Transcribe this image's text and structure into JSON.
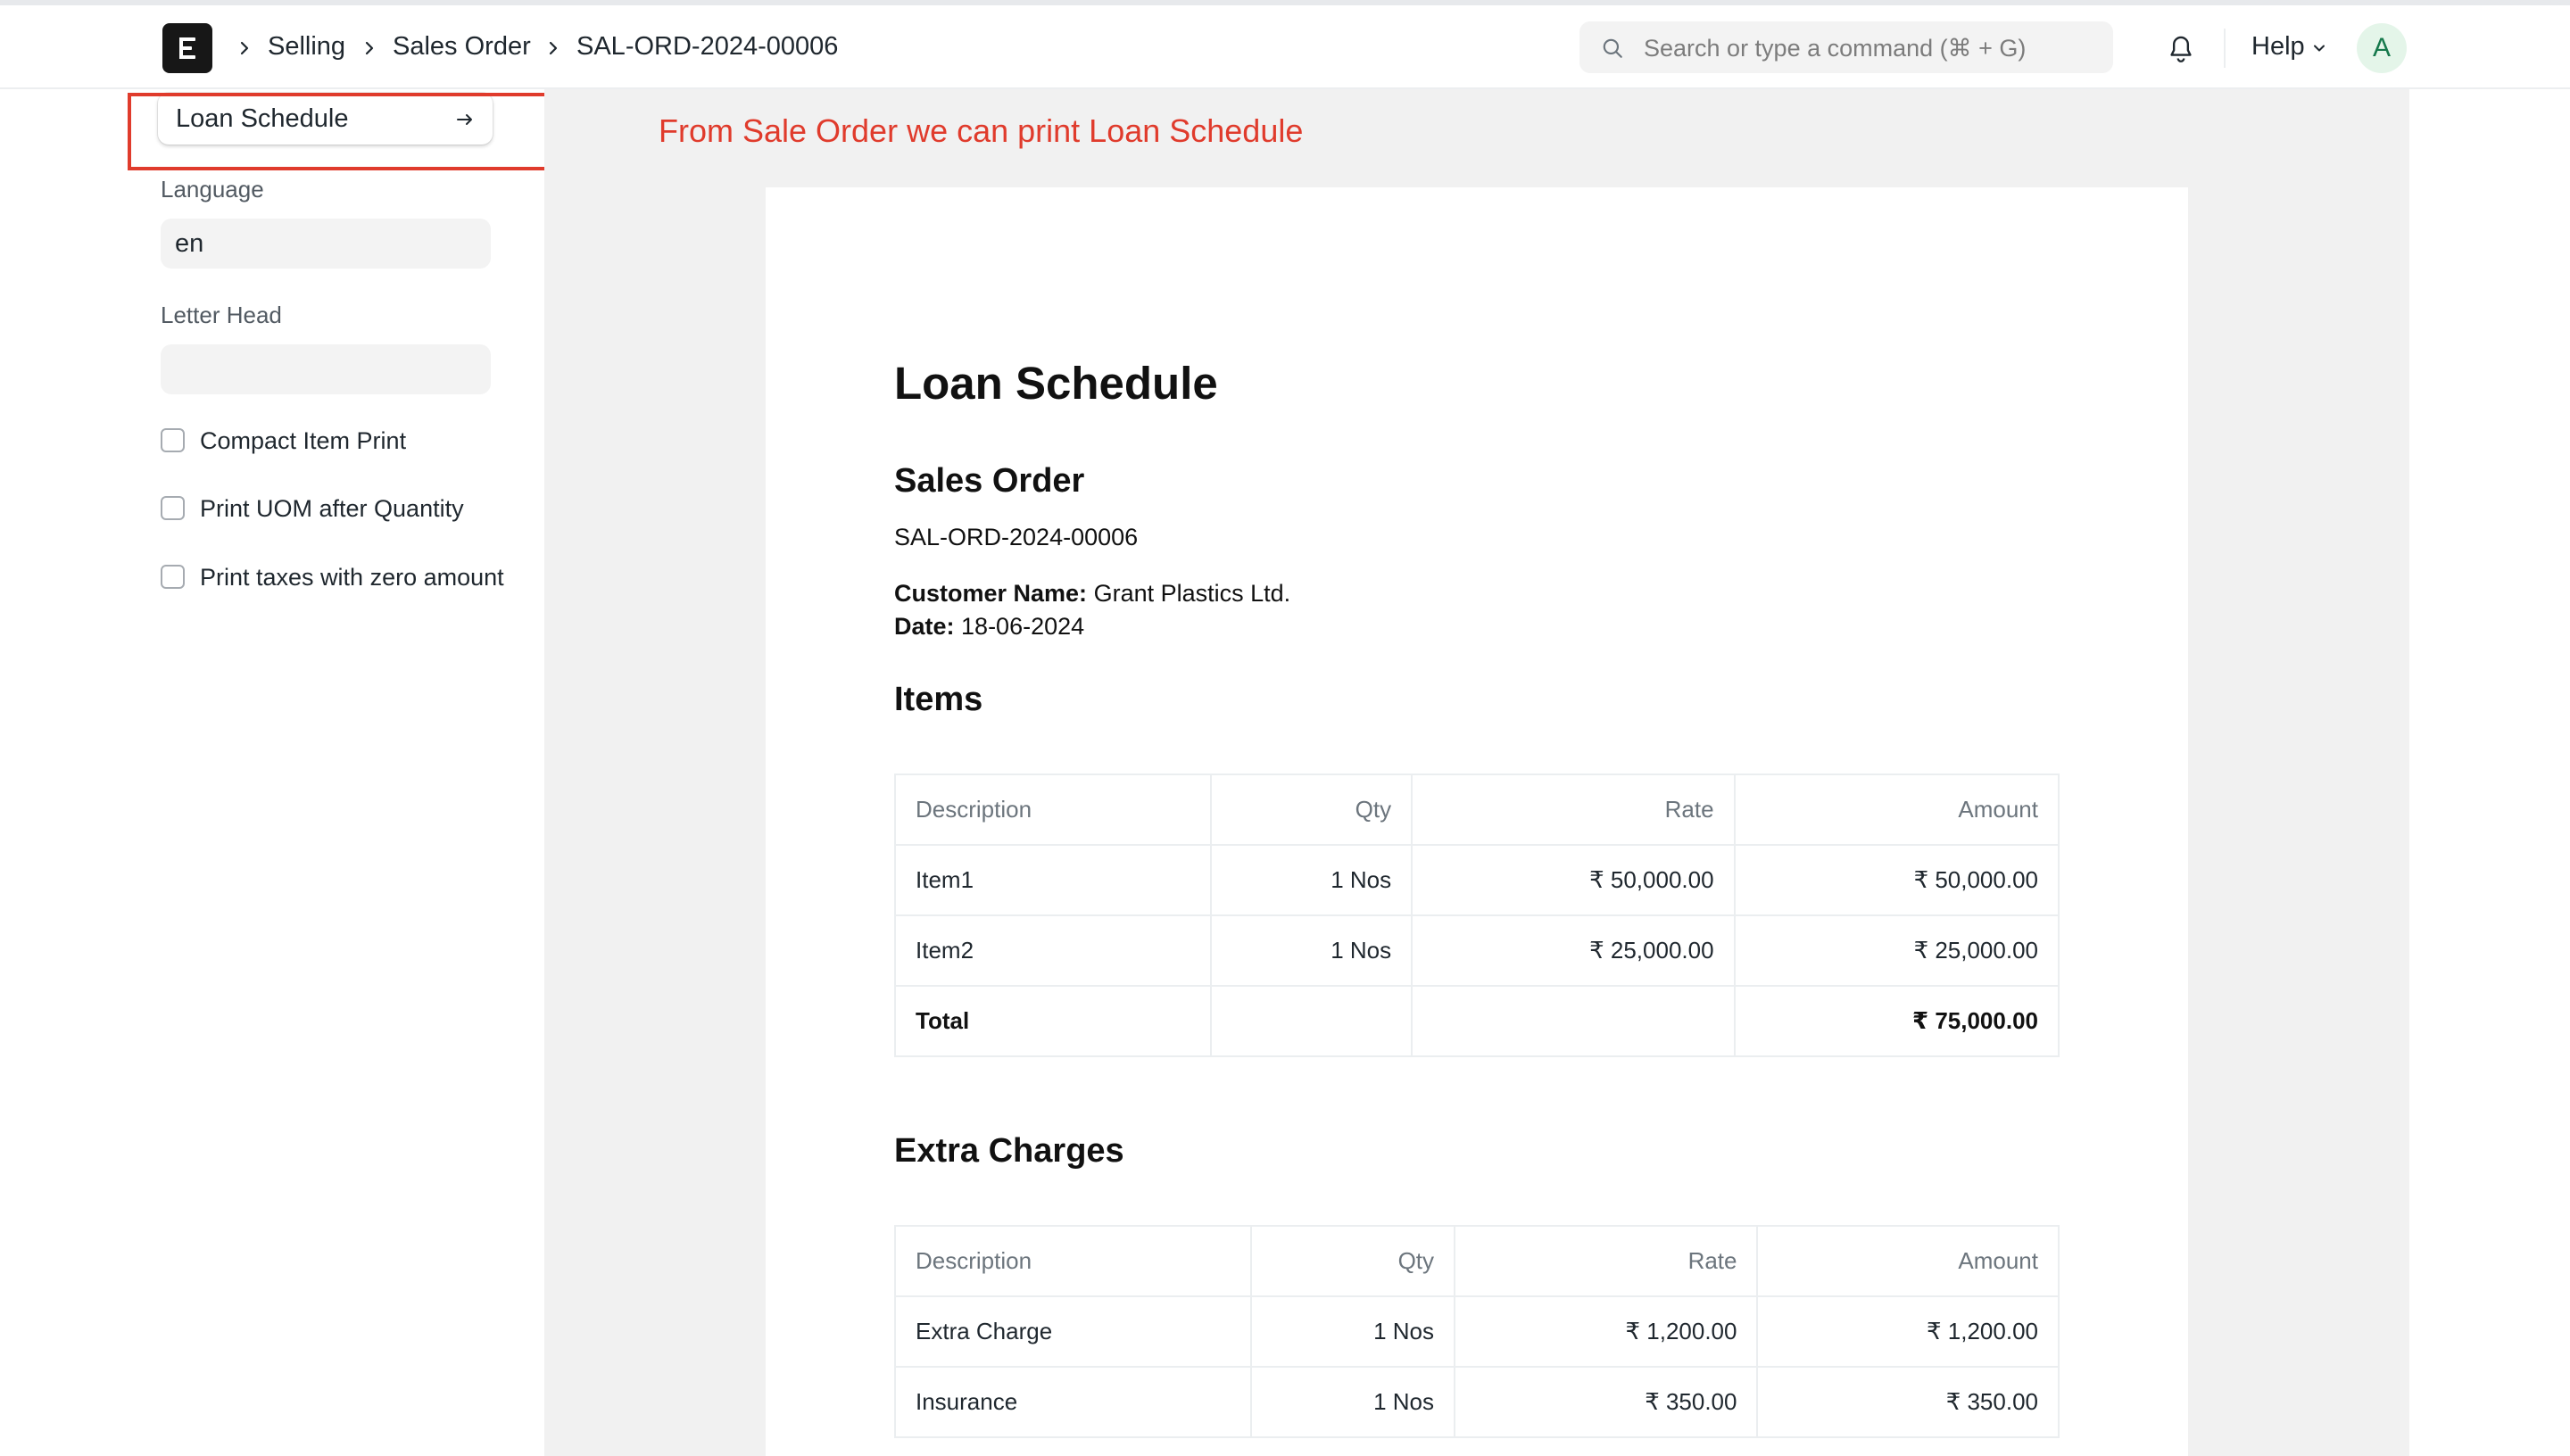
{
  "navbar": {
    "breadcrumbs": [
      "Selling",
      "Sales Order",
      "SAL-ORD-2024-00006"
    ],
    "search_placeholder": "Search or type a command (⌘ + G)",
    "help_label": "Help",
    "avatar_initial": "A"
  },
  "sidebar": {
    "print_format_button": "Loan Schedule",
    "language_label": "Language",
    "language_value": "en",
    "letter_head_label": "Letter Head",
    "letter_head_value": "",
    "checkboxes": [
      {
        "label": "Compact Item Print",
        "checked": false
      },
      {
        "label": "Print UOM after Quantity",
        "checked": false
      },
      {
        "label": "Print taxes with zero amount",
        "checked": false
      }
    ]
  },
  "annotation": "From Sale Order we can print Loan Schedule",
  "document": {
    "title": "Loan Schedule",
    "section_heading": "Sales Order",
    "order_id": "SAL-ORD-2024-00006",
    "customer_label": "Customer Name:",
    "customer_value": "Grant Plastics Ltd.",
    "date_label": "Date:",
    "date_value": "18-06-2024",
    "items": {
      "heading": "Items",
      "columns": [
        "Description",
        "Qty",
        "Rate",
        "Amount"
      ],
      "rows": [
        {
          "description": "Item1",
          "qty": "1 Nos",
          "rate": "₹ 50,000.00",
          "amount": "₹ 50,000.00"
        },
        {
          "description": "Item2",
          "qty": "1 Nos",
          "rate": "₹ 25,000.00",
          "amount": "₹ 25,000.00"
        }
      ],
      "total_label": "Total",
      "total_amount": "₹ 75,000.00"
    },
    "extra_charges": {
      "heading": "Extra Charges",
      "columns": [
        "Description",
        "Qty",
        "Rate",
        "Amount"
      ],
      "rows": [
        {
          "description": "Extra Charge",
          "qty": "1 Nos",
          "rate": "₹ 1,200.00",
          "amount": "₹ 1,200.00"
        },
        {
          "description": "Insurance",
          "qty": "1 Nos",
          "rate": "₹ 350.00",
          "amount": "₹ 350.00"
        }
      ]
    }
  },
  "colors": {
    "annotation_red": "#e03b2c",
    "avatar_bg": "#e4f5e9",
    "avatar_text": "#16794c",
    "preview_bg": "#f1f1f1"
  }
}
